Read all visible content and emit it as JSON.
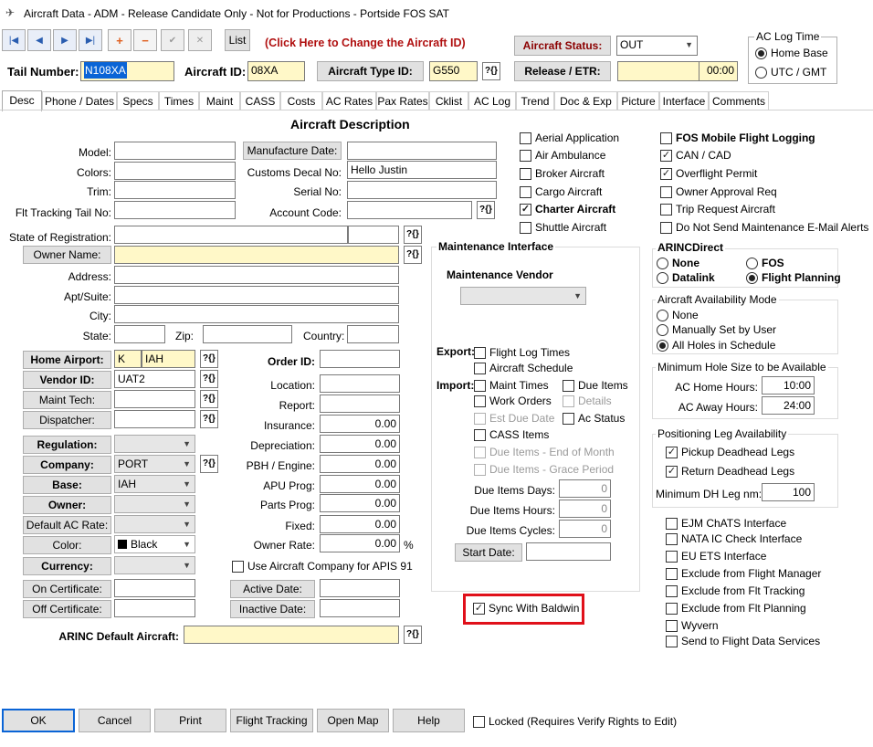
{
  "window": {
    "title": "Aircraft Data - ADM - Release Candidate Only - Not for Productions - Portside FOS SAT"
  },
  "toolbar": {
    "list_label": "List",
    "change_id_hint": "(Click Here to Change the Aircraft ID)",
    "aircraft_status_label": "Aircraft Status:",
    "aircraft_status_value": "OUT",
    "release_etr_label": "Release / ETR:",
    "release_time": "00:00"
  },
  "ac_log_time": {
    "title": "AC Log Time",
    "home_base": "Home Base",
    "utc_gmt": "UTC / GMT"
  },
  "header": {
    "tail_number_label": "Tail Number:",
    "tail_number_value": "N108XA",
    "aircraft_id_label": "Aircraft ID:",
    "aircraft_id_value": "08XA",
    "aircraft_type_id_label": "Aircraft Type ID:",
    "aircraft_type_id_value": "G550"
  },
  "tabs": [
    "Desc",
    "Phone / Dates",
    "Specs",
    "Times",
    "Maint",
    "CASS",
    "Costs",
    "AC Rates",
    "Pax Rates",
    "Cklist",
    "AC Log",
    "Trend",
    "Doc & Exp",
    "Picture",
    "Interface",
    "Comments"
  ],
  "desc": {
    "section_title": "Aircraft Description",
    "model_label": "Model:",
    "colors_label": "Colors:",
    "trim_label": "Trim:",
    "flt_tracking_label": "Flt Tracking Tail No:",
    "manufacture_date_label": "Manufacture Date:",
    "customs_decal_label": "Customs Decal No:",
    "customs_decal_value": "Hello Justin",
    "serial_no_label": "Serial No:",
    "account_code_label": "Account Code:",
    "state_registration_label": "State of Registration:",
    "owner_name_label": "Owner Name:",
    "address_label": "Address:",
    "apt_suite_label": "Apt/Suite:",
    "city_label": "City:",
    "state_label": "State:",
    "zip_label": "Zip:",
    "country_label": "Country:",
    "home_airport_label": "Home Airport:",
    "home_airport_prefix": "K",
    "home_airport_value": "IAH",
    "vendor_id_label": "Vendor ID:",
    "vendor_id_value": "UAT2",
    "maint_tech_label": "Maint Tech:",
    "dispatcher_label": "Dispatcher:",
    "regulation_label": "Regulation:",
    "company_label": "Company:",
    "company_value": "PORT",
    "base_label": "Base:",
    "base_value": "IAH",
    "owner_label": "Owner:",
    "default_ac_rate_label": "Default AC Rate:",
    "color_label": "Color:",
    "color_value": "Black",
    "currency_label": "Currency:",
    "on_certificate_label": "On Certificate:",
    "off_certificate_label": "Off Certificate:",
    "arinc_default_label": "ARINC Default Aircraft:",
    "order_id_label": "Order ID:",
    "location_label": "Location:",
    "report_label": "Report:",
    "insurance_label": "Insurance:",
    "insurance_value": "0.00",
    "depreciation_label": "Depreciation:",
    "depreciation_value": "0.00",
    "pbh_engine_label": "PBH / Engine:",
    "pbh_engine_value": "0.00",
    "apu_prog_label": "APU Prog:",
    "apu_prog_value": "0.00",
    "parts_prog_label": "Parts Prog:",
    "parts_prog_value": "0.00",
    "fixed_label": "Fixed:",
    "fixed_value": "0.00",
    "owner_rate_label": "Owner Rate:",
    "owner_rate_value": "0.00",
    "owner_rate_unit": "%",
    "use_company_apis": "Use Aircraft Company for APIS 91",
    "active_date_label": "Active Date:",
    "inactive_date_label": "Inactive Date:"
  },
  "types": {
    "aerial_application": "Aerial Application",
    "air_ambulance": "Air Ambulance",
    "broker_aircraft": "Broker Aircraft",
    "cargo_aircraft": "Cargo Aircraft",
    "charter_aircraft": "Charter Aircraft",
    "shuttle_aircraft": "Shuttle Aircraft",
    "fos_mobile": "FOS Mobile Flight Logging",
    "can_cad": "CAN / CAD",
    "overflight_permit": "Overflight Permit",
    "owner_approval": "Owner Approval Req",
    "trip_request": "Trip Request Aircraft",
    "no_maint_email": "Do Not Send Maintenance E-Mail Alerts"
  },
  "maintenance": {
    "title": "Maintenance Interface",
    "vendor_label": "Maintenance Vendor",
    "export_label": "Export:",
    "flight_log_times": "Flight Log Times",
    "aircraft_schedule": "Aircraft Schedule",
    "import_label": "Import:",
    "maint_times": "Maint Times",
    "due_items": "Due Items",
    "work_orders": "Work Orders",
    "details": "Details",
    "est_due_date": "Est Due Date",
    "ac_status": "Ac Status",
    "cass_items": "CASS Items",
    "due_items_eom": "Due Items - End of Month",
    "due_items_grace": "Due Items - Grace Period",
    "due_items_days_label": "Due Items Days:",
    "due_items_days_value": "0",
    "due_items_hours_label": "Due Items Hours:",
    "due_items_hours_value": "0",
    "due_items_cycles_label": "Due Items Cycles:",
    "due_items_cycles_value": "0",
    "start_date_label": "Start Date:",
    "sync_baldwin": "Sync With Baldwin"
  },
  "arinc": {
    "title": "ARINCDirect",
    "none": "None",
    "fos": "FOS",
    "datalink": "Datalink",
    "flight_planning": "Flight Planning"
  },
  "availability": {
    "title": "Aircraft Availability Mode",
    "none": "None",
    "manual": "Manually Set by User",
    "all_holes": "All Holes in Schedule"
  },
  "min_hole": {
    "title": "Minimum Hole Size to be Available",
    "home_label": "AC Home Hours:",
    "home_value": "10:00",
    "away_label": "AC Away Hours:",
    "away_value": "24:00"
  },
  "positioning": {
    "title": "Positioning Leg Availability",
    "pickup": "Pickup Deadhead Legs",
    "return": "Return Deadhead Legs",
    "min_dh_label": "Minimum DH Leg nm:",
    "min_dh_value": "100"
  },
  "interfaces": {
    "ejm": "EJM ChATS Interface",
    "nata": "NATA IC Check Interface",
    "eu_ets": "EU ETS Interface",
    "excl_flight_manager": "Exclude from Flight Manager",
    "excl_flt_tracking": "Exclude from Flt Tracking",
    "excl_flt_planning": "Exclude from Flt Planning",
    "wyvern": "Wyvern",
    "send_fds": "Send to Flight Data Services"
  },
  "footer": {
    "ok": "OK",
    "cancel": "Cancel",
    "print": "Print",
    "flight_tracking": "Flight Tracking",
    "open_map": "Open Map",
    "help": "Help",
    "locked": "Locked (Requires Verify Rights to Edit)"
  }
}
